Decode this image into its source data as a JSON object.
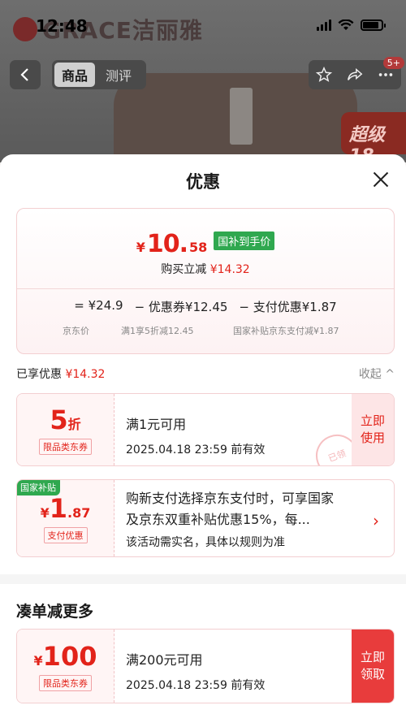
{
  "status_bar": {
    "time": "12:48"
  },
  "bg": {
    "brand": "GRACE洁丽雅",
    "tab_product": "商品",
    "tab_review": "测评",
    "back_label": "<",
    "badge": "5+",
    "banner": "超级18"
  },
  "sheet": {
    "title": "优惠",
    "final_yen": "¥",
    "final_int": "10.",
    "final_dec": "58",
    "final_badge": "国补到手价",
    "save_label": "购买立减",
    "save_amount": "¥14.32",
    "breakdown": {
      "jd_price": "= ¥24.9",
      "coupon": "− 优惠券¥12.45",
      "pay": "− 支付优惠¥1.87",
      "jd_price_sub": "京东价",
      "coupon_sub": "满1享5折减12.45",
      "pay_sub": "国家补贴京东支付减¥1.87"
    },
    "enjoyed_label": "已享优惠",
    "enjoyed_amount": "¥14.32",
    "collapse": "收起 ^"
  },
  "coupons": [
    {
      "value_big": "5",
      "value_small": "折",
      "tag": "限品类东券",
      "line1": "满1元可用",
      "line2": "2025.04.18 23:59 前有效",
      "action": "立即\n使用",
      "stamp": "已领"
    },
    {
      "corner_tag": "国家补贴",
      "yen": "¥",
      "value_big": "1",
      "value_small": ".87",
      "tag": "支付优惠",
      "line1": "购新支付选择京东支付时，可享国家",
      "line1b": "及京东双重补贴优惠15%，每...",
      "line2": "该活动需实名，具体以规则为准",
      "arrow": "›"
    }
  ],
  "more": {
    "title": "凑单减更多",
    "coupon": {
      "yen": "¥",
      "value_big": "100",
      "tag": "限品类东券",
      "line1": "满200元可用",
      "line2": "2025.04.18 23:59 前有效",
      "action": "立即\n领取"
    }
  }
}
